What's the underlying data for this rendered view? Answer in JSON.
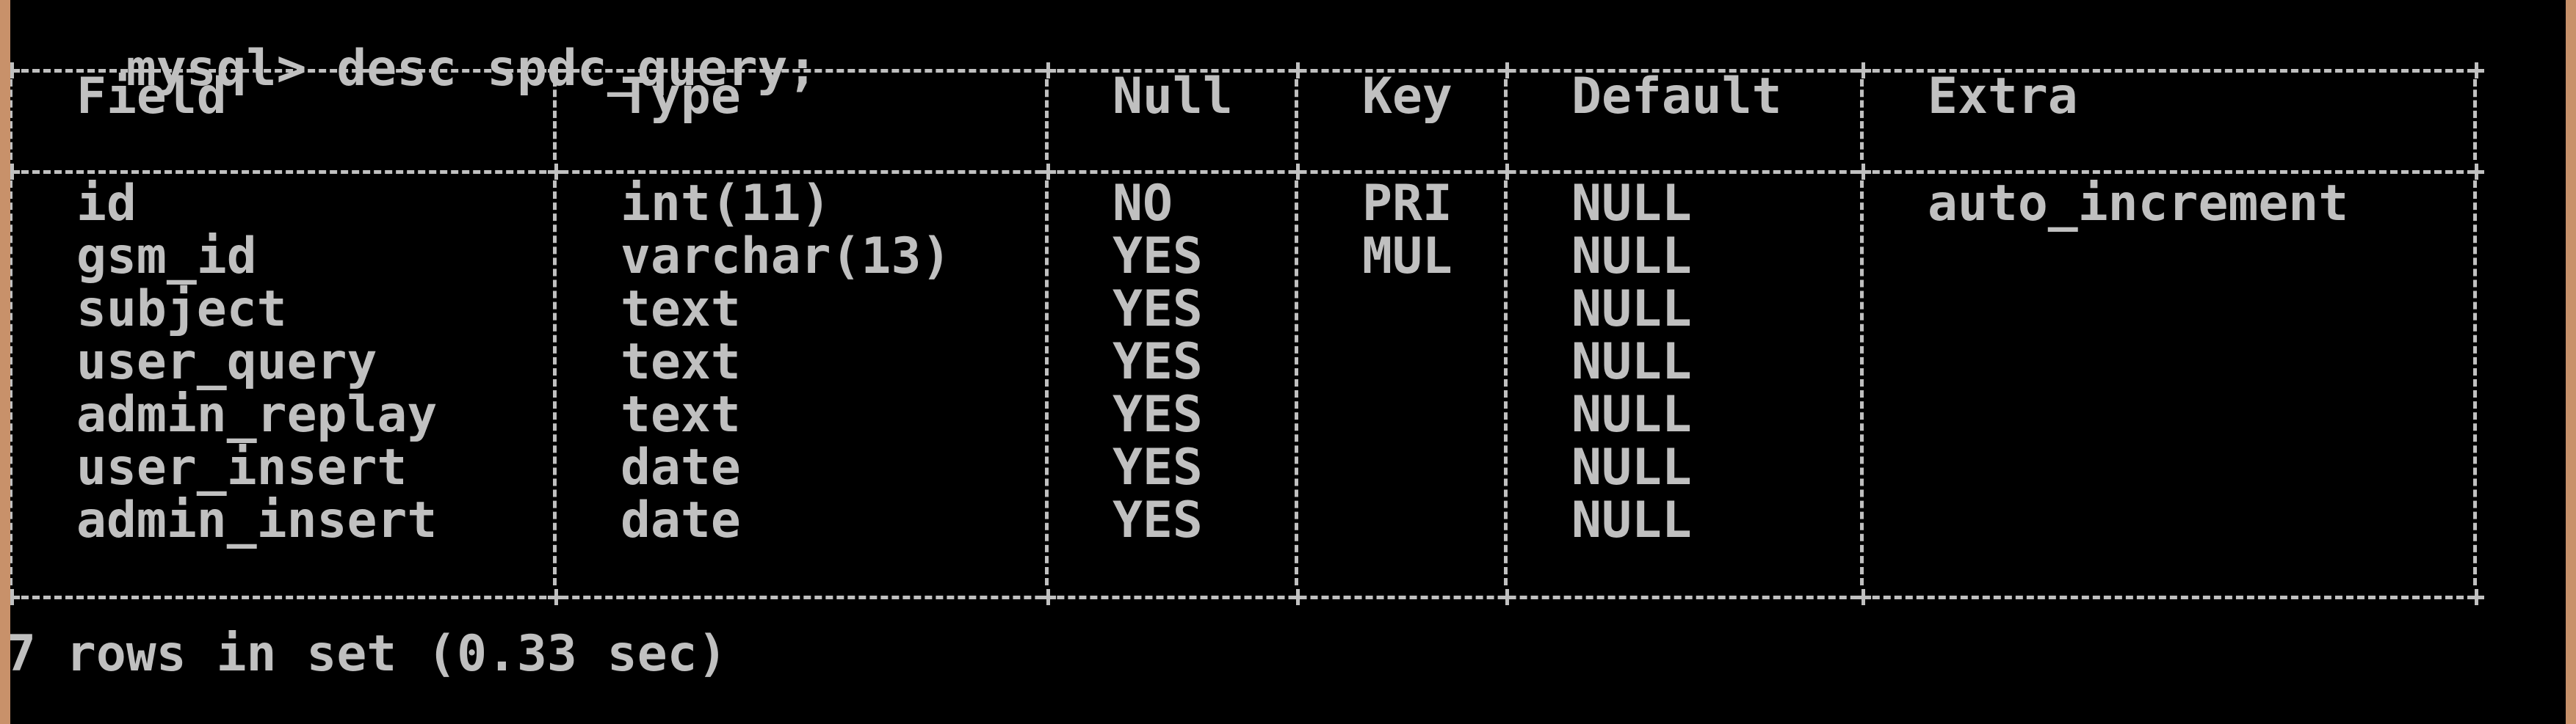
{
  "console": {
    "prompt": "mysql>",
    "command": "desc spdc_query;",
    "table": {
      "headers": [
        "Field",
        "Type",
        "Null",
        "Key",
        "Default",
        "Extra"
      ],
      "rows": [
        [
          "id",
          "int(11)",
          "NO",
          "PRI",
          "NULL",
          "auto_increment"
        ],
        [
          "gsm_id",
          "varchar(13)",
          "YES",
          "MUL",
          "NULL",
          ""
        ],
        [
          "subject",
          "text",
          "YES",
          "",
          "NULL",
          ""
        ],
        [
          "user_query",
          "text",
          "YES",
          "",
          "NULL",
          ""
        ],
        [
          "admin_replay",
          "text",
          "YES",
          "",
          "NULL",
          ""
        ],
        [
          "user_insert",
          "date",
          "YES",
          "",
          "NULL",
          ""
        ],
        [
          "admin_insert",
          "date",
          "YES",
          "",
          "NULL",
          ""
        ]
      ]
    },
    "result_summary": "7 rows in set (0.33 sec)"
  }
}
